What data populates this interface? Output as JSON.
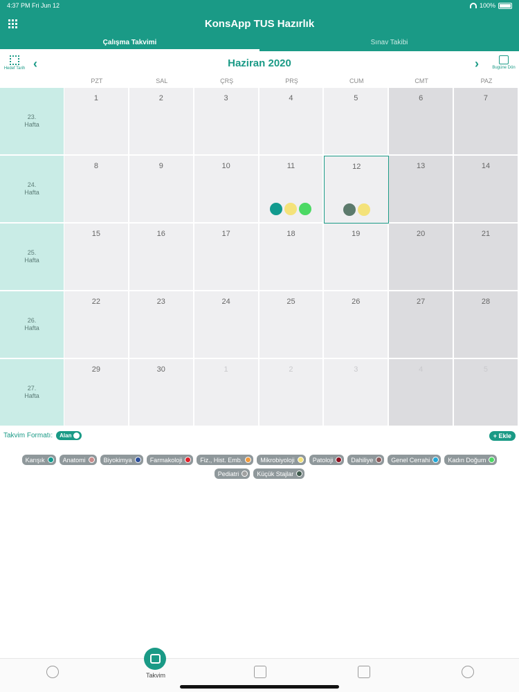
{
  "status": {
    "time": "4:37 PM",
    "date": "Fri Jun 12",
    "battery": "100%"
  },
  "app": {
    "title": "KonsApp TUS Hazırlık"
  },
  "tabs": [
    {
      "label": "Çalışma Takvimi",
      "active": true
    },
    {
      "label": "Sınav Takibi",
      "active": false
    }
  ],
  "month": {
    "title": "Haziran 2020",
    "hedef_label": "Hedef Tarih",
    "today_label": "Bugüne Dön"
  },
  "weekdays": [
    "PZT",
    "SAL",
    "ÇRŞ",
    "PRŞ",
    "CUM",
    "CMT",
    "PAZ"
  ],
  "weeks": [
    {
      "label": "23.\nHafta",
      "days": [
        "1",
        "2",
        "3",
        "4",
        "5",
        "6",
        "7"
      ]
    },
    {
      "label": "24.\nHafta",
      "days": [
        "8",
        "9",
        "10",
        "11",
        "12",
        "13",
        "14"
      ]
    },
    {
      "label": "25.\nHafta",
      "days": [
        "15",
        "16",
        "17",
        "18",
        "19",
        "20",
        "21"
      ]
    },
    {
      "label": "26.\nHafta",
      "days": [
        "22",
        "23",
        "24",
        "25",
        "26",
        "27",
        "28"
      ]
    },
    {
      "label": "27.\nHafta",
      "days": [
        "29",
        "30",
        "1",
        "2",
        "3",
        "4",
        "5"
      ]
    }
  ],
  "today": "12",
  "events": {
    "11": [
      "#119a8e",
      "#f4e27a",
      "#4cd964"
    ],
    "12": [
      "#5c7a6c",
      "#f4e27a"
    ]
  },
  "format": {
    "label": "Takvim Formatı:",
    "toggle": "Alan"
  },
  "add_label": "+ Ekle",
  "legend": [
    {
      "label": "Karışık",
      "color": "#119a8e"
    },
    {
      "label": "Anatomi",
      "color": "#c98c8c"
    },
    {
      "label": "Biyokimya",
      "color": "#2d4f9c"
    },
    {
      "label": "Farmakoloji",
      "color": "#e0202a"
    },
    {
      "label": "Fiz., Hist. Emb.",
      "color": "#f19a3e"
    },
    {
      "label": "Mikrobiyoloji",
      "color": "#f4e27a"
    },
    {
      "label": "Patoloji",
      "color": "#8e1020"
    },
    {
      "label": "Dahiliye",
      "color": "#8a5a5a"
    },
    {
      "label": "Genel Cerrahi",
      "color": "#20a8d8"
    },
    {
      "label": "Kadın Doğum",
      "color": "#4cd964"
    },
    {
      "label": "Pediatri",
      "color": "#a0a0a0"
    },
    {
      "label": "Küçük Stajlar",
      "color": "#3f5b4d"
    }
  ],
  "bottom_tabs": [
    {
      "icon": "stopwatch-icon",
      "label": ""
    },
    {
      "icon": "calendar-clock-icon",
      "label": "Takvim",
      "active": true
    },
    {
      "icon": "stats-icon",
      "label": ""
    },
    {
      "icon": "image-icon",
      "label": ""
    },
    {
      "icon": "profile-icon",
      "label": ""
    }
  ]
}
